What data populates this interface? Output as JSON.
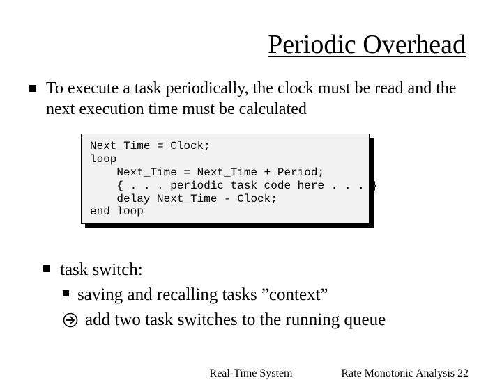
{
  "title": "Periodic Overhead",
  "bullet1": "To execute a task periodically, the clock must be read and the next execution time must be calculated",
  "code": "Next_Time = Clock;\nloop\n    Next_Time = Next_Time + Period;\n    { . . . periodic task code here . . . }\n    delay Next_Time - Clock;\nend loop",
  "bullet2": "task switch:",
  "bullet2a": "saving and recalling tasks ”context”",
  "bullet2b": "add two task switches to the running queue",
  "footer_center": "Real-Time System",
  "footer_right_label": "Rate Monotonic Analysis",
  "footer_right_num": "22"
}
